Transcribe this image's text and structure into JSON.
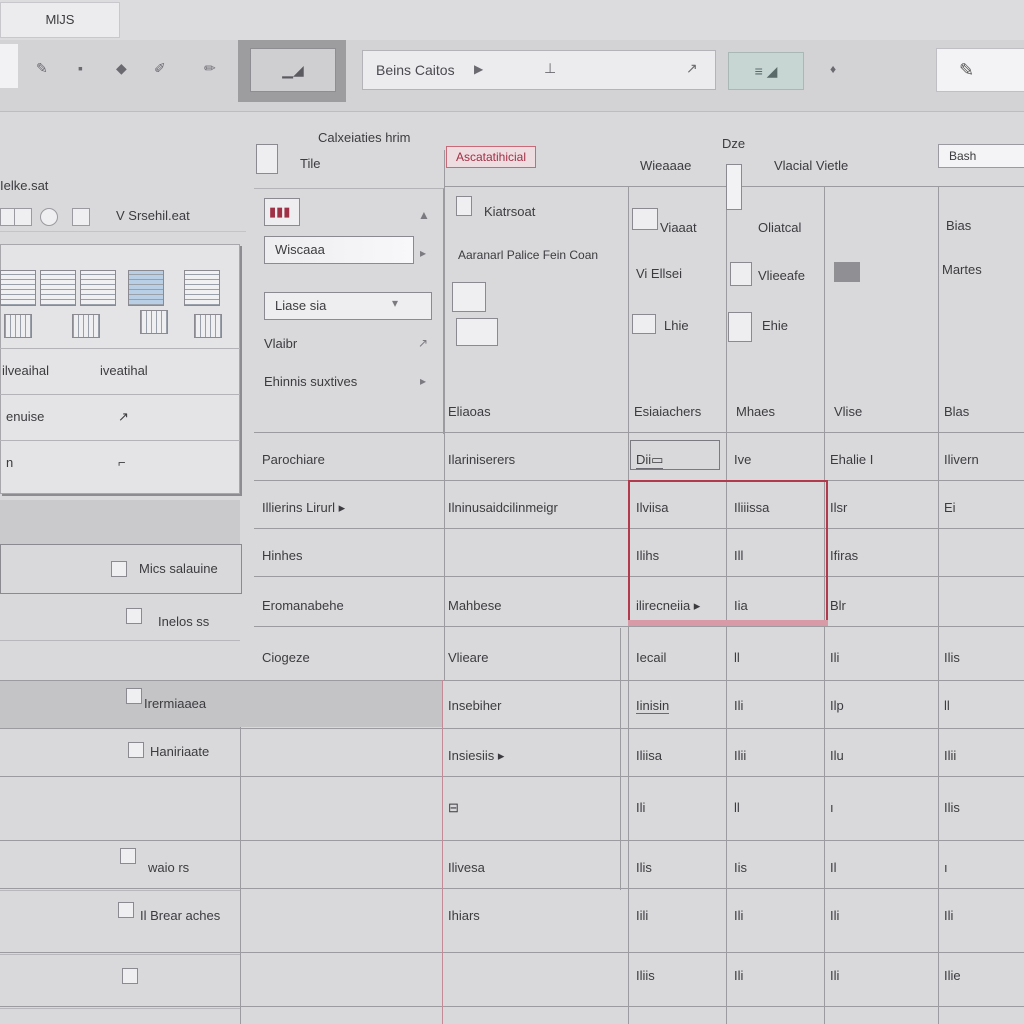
{
  "app": {
    "tab_title": "MlJS"
  },
  "toolbar": {
    "highlight_button": "▁◢",
    "search": {
      "value": "Beins Caitos",
      "arrow": "▶",
      "cursor": "⊥",
      "icon": "↗"
    },
    "swatch_button": "≡ ◢",
    "pin_icon": "♦",
    "right_button": "✎"
  },
  "sidebar": {
    "title": "Ielke.sat",
    "search_label": "V Srsehil.eat",
    "panel_rows": [
      {
        "left": "ilveaihal",
        "right": "iveatihal"
      },
      {
        "left": "enuise",
        "right": "↗"
      },
      {
        "left": "n",
        "right": "⌐"
      }
    ],
    "list": [
      {
        "label": ""
      },
      {
        "label": "Mics salauine"
      },
      {
        "label": "Inelos ss"
      },
      {
        "label": ""
      },
      {
        "label": "Irermiaaea"
      },
      {
        "label": "Haniriaate"
      },
      {
        "label": ""
      },
      {
        "label": "waio rs"
      },
      {
        "label": "Il Brear aches"
      },
      {
        "label": ""
      }
    ]
  },
  "middle": {
    "header_title": "Calxeiaties hrim",
    "header_sub": "Tile",
    "fields": [
      {
        "label": "",
        "value": "▮▮▮"
      },
      {
        "label": "",
        "value": "Wiscaaa"
      },
      {
        "label": "",
        "value": "Liase sia"
      },
      {
        "label": "Vlaibr",
        "value": ""
      },
      {
        "label": "Ehinnis suxtives",
        "value": ""
      }
    ]
  },
  "grid": {
    "red_tag": "Ascatatihicial",
    "top_tag": "Bash",
    "headers": [
      "Wieaaae",
      "Dze",
      "Vlacial Vietle"
    ],
    "detail_lines": [
      "Kiatrsoat",
      "Aaranarl Palice Fein Coan"
    ],
    "col3_items": [
      "Viaaat",
      "Vi Ellsei",
      "Lhie"
    ],
    "col4_items": [
      "Oliatcal",
      "Vlieeafe",
      "Ehie"
    ],
    "col6_items": [
      "Bias",
      "Martes"
    ],
    "subheaders": [
      "Eliaoas",
      "Esiaiachers",
      "Mhaes",
      "Vlise",
      "Blas"
    ],
    "rows": [
      {
        "c1": "Parochiare",
        "c2": "Ilariniserers",
        "c3": "Dii▭",
        "c4": "Ive",
        "c5": "Ehalie I",
        "c6": "Ilivern"
      },
      {
        "c1": "Illierins Lirurl ▸",
        "c2": "Ilninusaidcilinmeigr",
        "c3": "Ilviisa",
        "c4": "Iliiissa",
        "c5": "Ilsr",
        "c6": "Ei"
      },
      {
        "c1": "Hinhes",
        "c2": "",
        "c3": "Ilihs",
        "c4": "Ill",
        "c5": "Ifiras",
        "c6": ""
      },
      {
        "c1": "Eromanabehe",
        "c2": "Mahbese",
        "c3": "ilirecneiia ▸",
        "c4": "Iia",
        "c5": "Blr",
        "c6": ""
      },
      {
        "c1": "Ciogeze",
        "c2": "Vlieare",
        "c3": "Iecail",
        "c4": "ll",
        "c5": "Ili",
        "c6": "Ilis"
      },
      {
        "c1": "",
        "c2": "Insebiher",
        "c3": "Iinisin",
        "c4": "Ili",
        "c5": "Ilp",
        "c6": "ll"
      },
      {
        "c1": "",
        "c2": "Insiesiis ▸",
        "c3": "Iliisa",
        "c4": "Ilii",
        "c5": "Ilu",
        "c6": "Ilii"
      },
      {
        "c1": "",
        "c2": "⊟",
        "c3": "Ili",
        "c4": "ll",
        "c5": "ı",
        "c6": "Ilis"
      },
      {
        "c1": "",
        "c2": "Ilivesa",
        "c3": "Ilis",
        "c4": "Iis",
        "c5": "Il",
        "c6": "ı"
      },
      {
        "c1": "",
        "c2": "Ihiars",
        "c3": "Iili",
        "c4": "Ili",
        "c5": "Ili",
        "c6": "Ili"
      },
      {
        "c1": "",
        "c2": "",
        "c3": "Iliis",
        "c4": "Ili",
        "c5": "Ili",
        "c6": "Ilie"
      }
    ]
  },
  "colors": {
    "accent_red": "#b23a4c",
    "background": "#d9d9db"
  }
}
